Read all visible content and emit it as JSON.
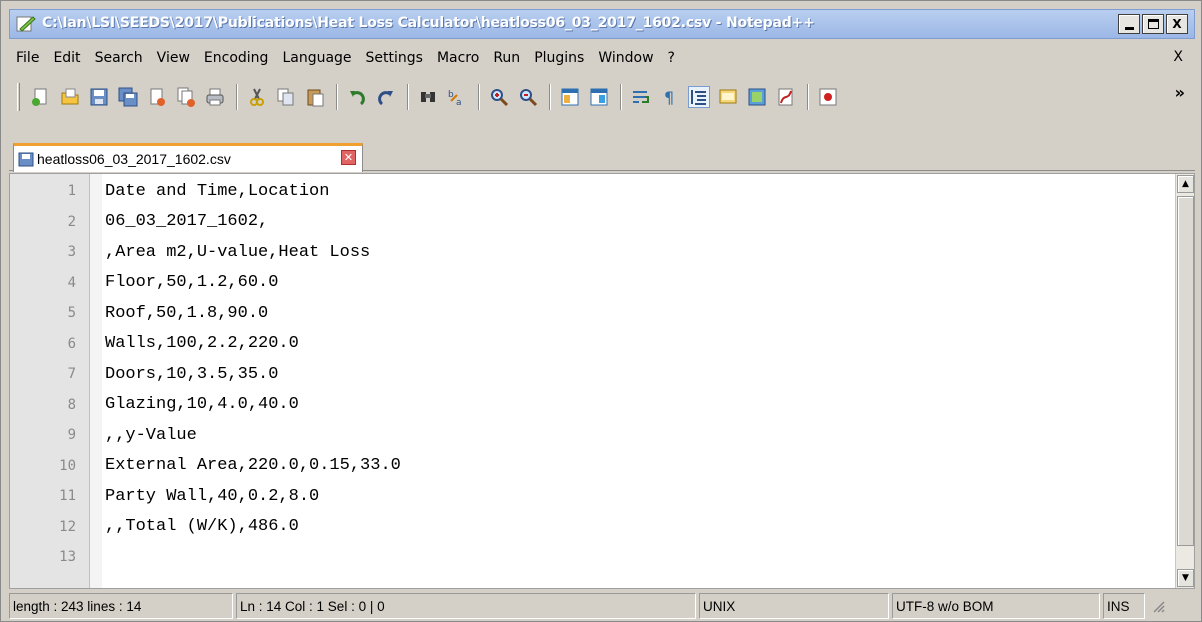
{
  "window": {
    "title": "C:\\Ian\\LSI\\SEEDS\\2017\\Publications\\Heat Loss Calculator\\heatloss06_03_2017_1602.csv - Notepad++",
    "controls": {
      "close": "X"
    }
  },
  "menu": {
    "items": [
      "File",
      "Edit",
      "Search",
      "View",
      "Encoding",
      "Language",
      "Settings",
      "Macro",
      "Run",
      "Plugins",
      "Window",
      "?"
    ],
    "close": "X"
  },
  "toolbar": {
    "icons": [
      "new-file-icon",
      "open-file-icon",
      "save-icon",
      "save-all-icon",
      "close-icon",
      "close-all-icon",
      "print-icon",
      "cut-icon",
      "copy-icon",
      "paste-icon",
      "undo-icon",
      "redo-icon",
      "find-icon",
      "replace-icon",
      "zoom-in-icon",
      "zoom-out-icon",
      "sync-vertical-icon",
      "sync-horizontal-icon",
      "word-wrap-icon",
      "show-all-chars-icon",
      "indent-guide-icon",
      "function-list-icon",
      "document-map-icon",
      "folder-icon",
      "record-macro-icon"
    ],
    "overflow": "»"
  },
  "tab": {
    "label": "heatloss06_03_2017_1602.csv",
    "close": "✕"
  },
  "editor": {
    "lines": [
      {
        "n": "1",
        "text": "Date and Time,Location"
      },
      {
        "n": "2",
        "text": "06_03_2017_1602,"
      },
      {
        "n": "3",
        "text": ",Area m2,U-value,Heat Loss"
      },
      {
        "n": "4",
        "text": "Floor,50,1.2,60.0"
      },
      {
        "n": "5",
        "text": "Roof,50,1.8,90.0"
      },
      {
        "n": "6",
        "text": "Walls,100,2.2,220.0"
      },
      {
        "n": "7",
        "text": "Doors,10,3.5,35.0"
      },
      {
        "n": "8",
        "text": "Glazing,10,4.0,40.0"
      },
      {
        "n": "9",
        "text": ",,y-Value"
      },
      {
        "n": "10",
        "text": "External Area,220.0,0.15,33.0"
      },
      {
        "n": "11",
        "text": "Party Wall,40,0.2,8.0"
      },
      {
        "n": "12",
        "text": ",,Total (W/K),486.0"
      },
      {
        "n": "13",
        "text": ""
      }
    ]
  },
  "status": {
    "length": "length : 243   lines : 14",
    "position": "Ln : 14   Col : 1   Sel : 0 | 0",
    "eol": "UNIX",
    "encoding": "UTF-8 w/o BOM",
    "mode": "INS"
  },
  "colors": {
    "tab_accent": "#f0a030",
    "titlebar": "#9bb7e6",
    "tab_close": "#e06464"
  }
}
